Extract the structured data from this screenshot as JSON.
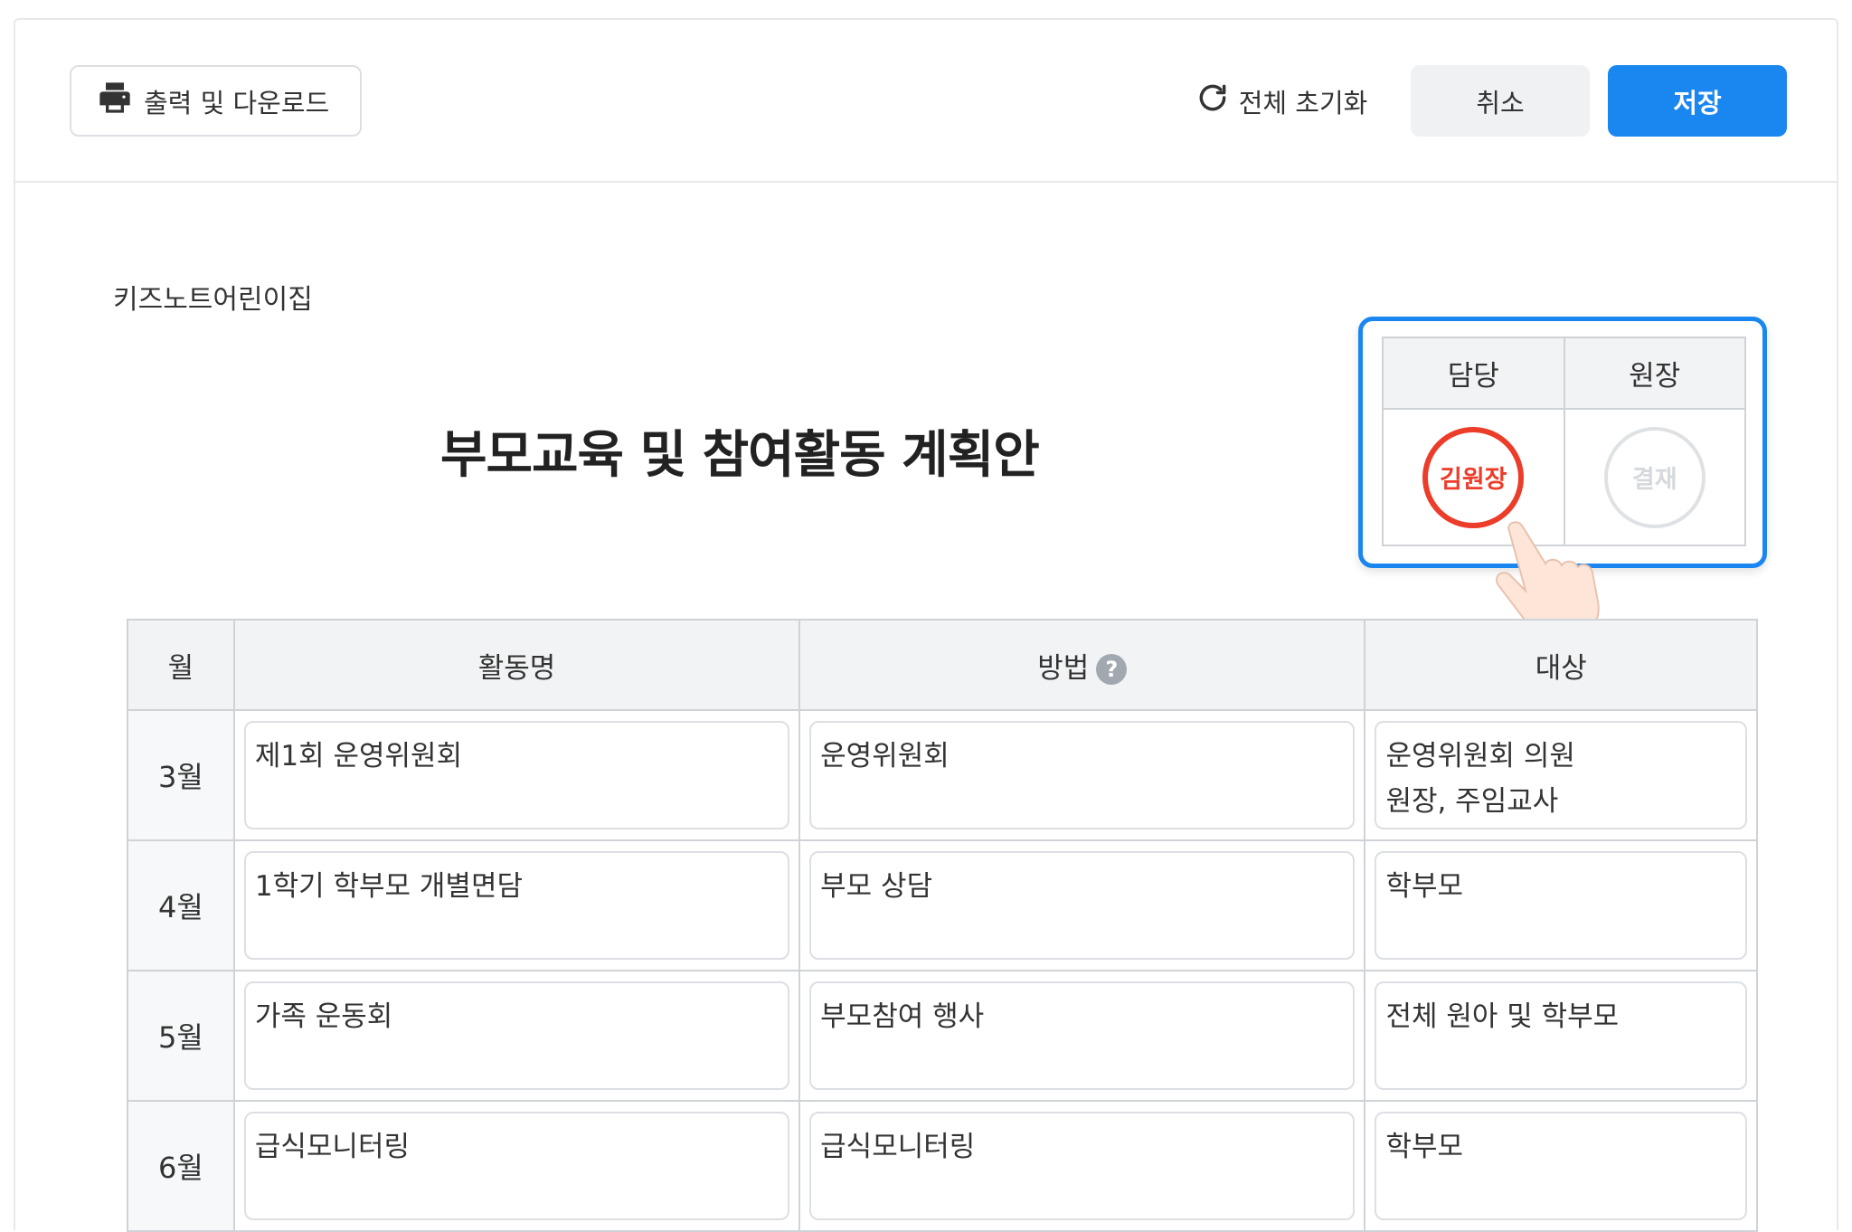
{
  "toolbar": {
    "print_label": "출력 및 다운로드",
    "reset_label": "전체 초기화",
    "cancel_label": "취소",
    "save_label": "저장"
  },
  "document": {
    "org_name": "키즈노트어린이집",
    "title": "부모교육 및 참여활동 계획안"
  },
  "approval": {
    "headers": [
      "담당",
      "원장"
    ],
    "stamps": [
      {
        "text": "김원장",
        "signed": true
      },
      {
        "text": "결재",
        "signed": false
      }
    ]
  },
  "table": {
    "headers": {
      "month": "월",
      "activity": "활동명",
      "method": "방법",
      "target": "대상"
    },
    "rows": [
      {
        "month": "3월",
        "activity": "제1회 운영위원회",
        "method": "운영위원회",
        "target": "운영위원회 의원\n원장, 주임교사"
      },
      {
        "month": "4월",
        "activity": "1학기 학부모 개별면담",
        "method": "부모 상담",
        "target": "학부모"
      },
      {
        "month": "5월",
        "activity": "가족 운동회",
        "method": "부모참여 행사",
        "target": "전체 원아 및 학부모"
      },
      {
        "month": "6월",
        "activity": "급식모니터링",
        "method": "급식모니터링",
        "target": "학부모"
      }
    ]
  },
  "icons": {
    "print": "printer-icon",
    "reset": "refresh-icon",
    "help": "help-icon",
    "pointer": "hand-pointer-icon"
  },
  "colors": {
    "primary": "#1a86f0",
    "stamp_red": "#ec3c2a"
  }
}
